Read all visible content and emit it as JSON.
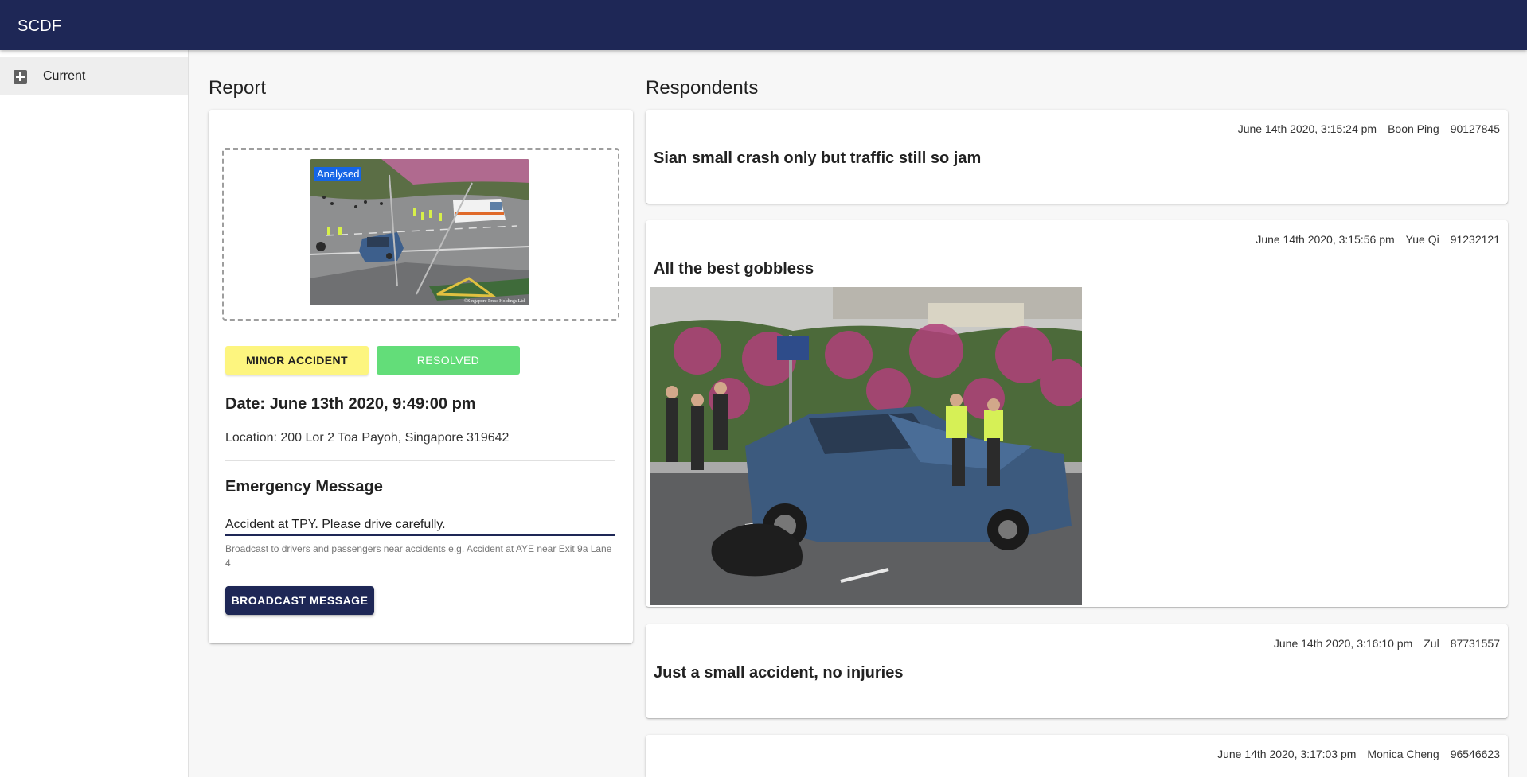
{
  "app": {
    "title": "SCDF"
  },
  "sidebar": {
    "items": [
      {
        "label": "Current",
        "icon": "add-box-icon"
      }
    ]
  },
  "report": {
    "section_title": "Report",
    "image_tag": "Analysed",
    "severity_label": "MINOR ACCIDENT",
    "status_label": "RESOLVED",
    "date": "Date: June 13th 2020, 9:49:00 pm",
    "location": "Location: 200 Lor 2 Toa Payoh, Singapore 319642",
    "emergency_title": "Emergency Message",
    "emergency_value": "Accident at TPY. Please drive carefully.",
    "emergency_helper": "Broadcast to drivers and passengers near accidents e.g. Accident at AYE near Exit 9a Lane 4",
    "broadcast_label": "BROADCAST MESSAGE"
  },
  "respondents": {
    "section_title": "Respondents",
    "items": [
      {
        "timestamp": "June 14th 2020, 3:15:24 pm",
        "name": "Boon Ping",
        "phone": "90127845",
        "message": "Sian small crash only but traffic still so jam"
      },
      {
        "timestamp": "June 14th 2020, 3:15:56 pm",
        "name": "Yue Qi",
        "phone": "91232121",
        "message": "All the best gobbless"
      },
      {
        "timestamp": "June 14th 2020, 3:16:10 pm",
        "name": "Zul",
        "phone": "87731557",
        "message": "Just a small accident, no injuries"
      },
      {
        "timestamp": "June 14th 2020, 3:17:03 pm",
        "name": "Monica Cheng",
        "phone": "96546623",
        "message": ""
      }
    ]
  },
  "colors": {
    "appbar": "#1e2756",
    "minor_chip": "#fdf57f",
    "resolved_chip": "#63dd79",
    "analysed_tag": "#1565e6"
  }
}
